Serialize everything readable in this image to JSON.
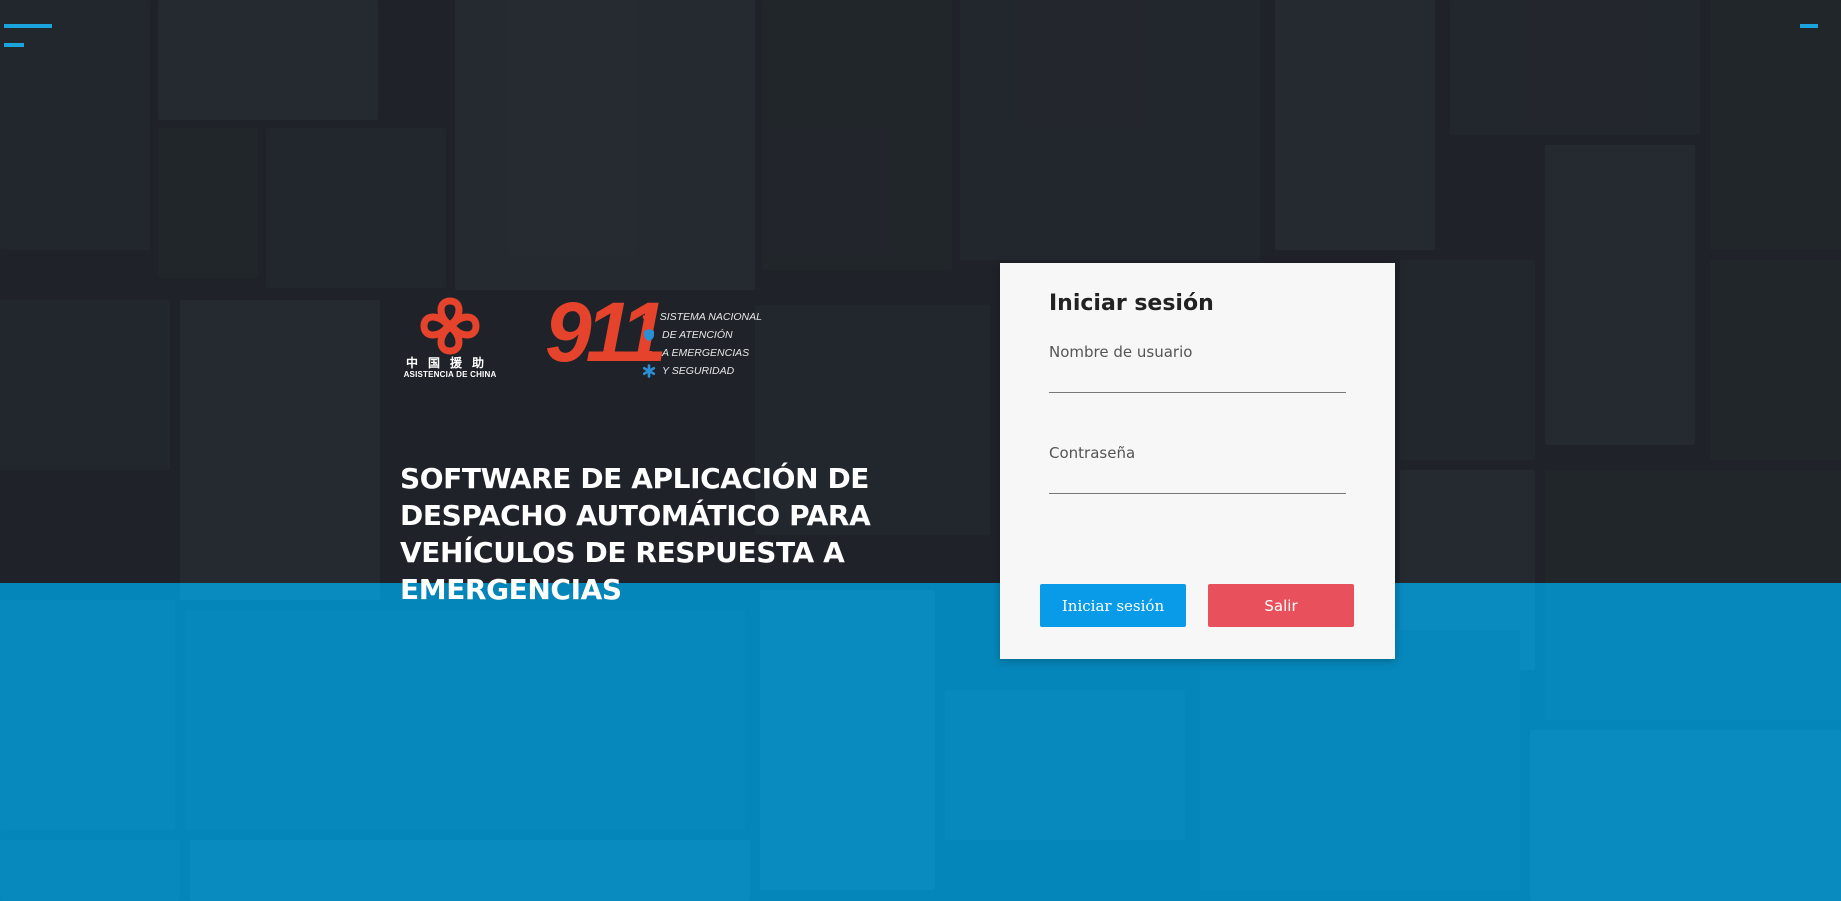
{
  "brand": {
    "china_logo_caption_cn": "中国援助",
    "china_logo_caption": "ASISTENCIA DE CHINA",
    "emergency_number": "911",
    "system_lines": [
      "SISTEMA NACIONAL",
      "DE ATENCIÓN",
      "A EMERGENCIAS",
      "Y SEGURIDAD"
    ]
  },
  "headline": "SOFTWARE DE APLICACIÓN DE DESPACHO AUTOMÁTICO PARA VEHÍCULOS DE RESPUESTA A EMERGENCIAS",
  "login": {
    "title": "Iniciar sesión",
    "username_label": "Nombre de usuario",
    "username_value": "",
    "password_label": "Contraseña",
    "password_value": "",
    "login_button": "Iniciar sesión",
    "exit_button": "Salir"
  },
  "colors": {
    "accent_blue": "#0a9be8",
    "exit_red": "#e8505b",
    "logo_red": "#e5432c"
  }
}
